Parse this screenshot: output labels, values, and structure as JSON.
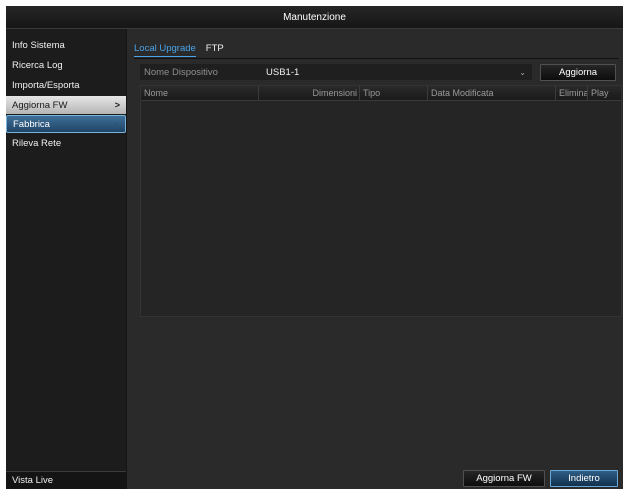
{
  "window": {
    "title": "Manutenzione"
  },
  "sidebar": {
    "items": [
      {
        "label": "Info Sistema"
      },
      {
        "label": "Ricerca Log"
      },
      {
        "label": "Importa/Esporta"
      },
      {
        "label": "Aggiorna FW",
        "chevron": ">"
      },
      {
        "label": "Fabbrica",
        "chevron": ">"
      },
      {
        "label": "Rileva Rete"
      }
    ],
    "live_view": "Vista Live"
  },
  "tabs": [
    {
      "label": "Local Upgrade"
    },
    {
      "label": "FTP"
    }
  ],
  "device": {
    "label": "Nome Dispositivo",
    "value": "USB1-1",
    "refresh_button": "Aggiorna"
  },
  "table": {
    "columns": [
      "Nome",
      "Dimensioni",
      "Tipo",
      "Data Modificata",
      "Elimina",
      "Play"
    ],
    "rows": []
  },
  "footer": {
    "update_button": "Aggiorna FW",
    "back_button": "Indietro"
  },
  "colors": {
    "accent": "#4aa3e8",
    "primary_button": "#2f5d86",
    "background": "#2b2b2b"
  }
}
